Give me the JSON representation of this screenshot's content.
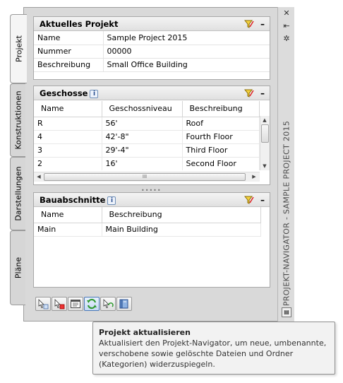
{
  "tabs": [
    {
      "label": "Projekt",
      "active": true
    },
    {
      "label": "Konstruktionen",
      "active": false
    },
    {
      "label": "Darstellungen",
      "active": false
    },
    {
      "label": "Pläne",
      "active": false
    }
  ],
  "palette_title": "PROJEKT-NAVIGATOR - SAMPLE PROJECT 2015",
  "sections": {
    "current_project": {
      "title": "Aktuelles Projekt",
      "rows": [
        {
          "key": "Name",
          "value": "Sample Project 2015"
        },
        {
          "key": "Nummer",
          "value": "00000"
        },
        {
          "key": "Beschreibung",
          "value": "Small Office Building"
        }
      ]
    },
    "levels": {
      "title": "Geschosse",
      "columns": [
        "Name",
        "Geschossniveau",
        "Beschreibung"
      ],
      "rows": [
        [
          "R",
          "56'",
          "Roof"
        ],
        [
          "4",
          "42'-8\"",
          "Fourth Floor"
        ],
        [
          "3",
          "29'-4\"",
          "Third Floor"
        ],
        [
          "2",
          "16'",
          "Second Floor"
        ]
      ],
      "hscroll_grip": "III"
    },
    "divisions": {
      "title": "Bauabschnitte",
      "columns": [
        "Name",
        "Beschreibung"
      ],
      "rows": [
        [
          "Main",
          "Main Building"
        ]
      ]
    }
  },
  "tooltip": {
    "title": "Projekt aktualisieren",
    "body": "Aktualisiert den Projekt-Navigator, um neue, umbenannte, verschobene sowie gelöschte Dateien und Ordner (Kategorien) widerzuspiegeln."
  },
  "colors": {
    "refresh_green": "#2f9a2f",
    "active_button": "#4b79b7"
  }
}
